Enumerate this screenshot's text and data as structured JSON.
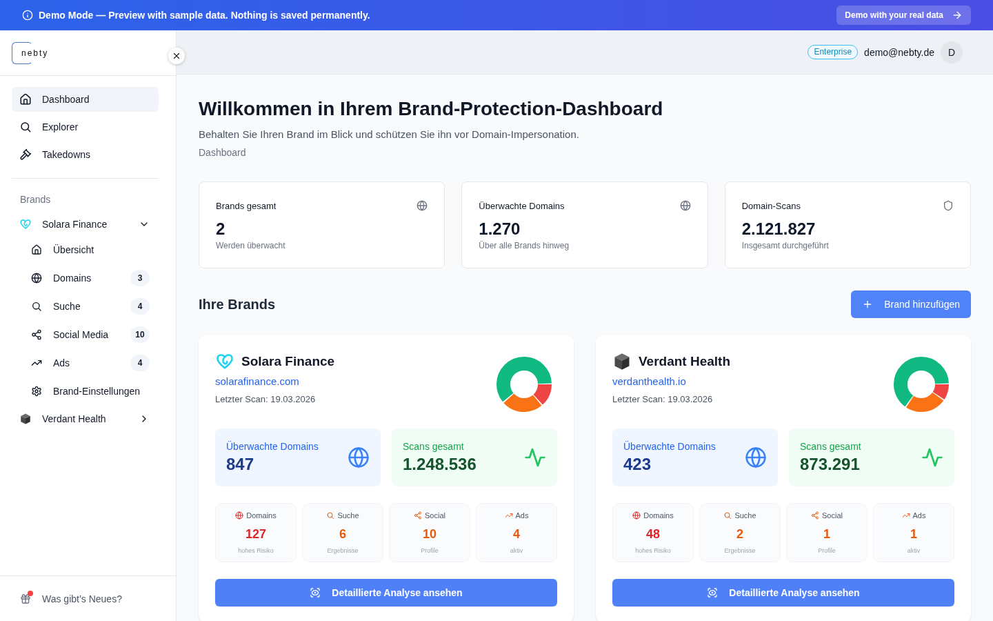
{
  "banner": {
    "title": "Demo Mode",
    "message": "— Preview with sample data. Nothing is saved permanently.",
    "action": "Demo with your real data"
  },
  "sidebar": {
    "logo": "nebty",
    "nav": [
      {
        "label": "Dashboard",
        "selected": true
      },
      {
        "label": "Explorer",
        "selected": false
      },
      {
        "label": "Takedowns",
        "selected": false
      }
    ],
    "section": "Brands",
    "brands": [
      {
        "name": "Solara Finance",
        "expanded": true,
        "children": [
          {
            "label": "Übersicht",
            "selected": false
          },
          {
            "label": "Domains",
            "count": "3",
            "selected": false
          },
          {
            "label": "Suche",
            "count": "4",
            "selected": false
          },
          {
            "label": "Social Media",
            "count": "10",
            "selected": false
          },
          {
            "label": "Ads",
            "count": "4",
            "selected": false
          },
          {
            "label": "Brand-Einstellungen",
            "selected": false
          }
        ]
      },
      {
        "name": "Verdant Health",
        "expanded": false
      }
    ],
    "footer": {
      "label": "Was gibt’s Neues?",
      "notification": true
    }
  },
  "header": {
    "plan": "Enterprise",
    "email": "demo@nebty.de",
    "avatar": "D"
  },
  "page": {
    "title": "Willkommen in Ihrem Brand-Protection-Dashboard",
    "subtitle": "Behalten Sie Ihren Brand im Blick und schützen Sie ihn vor Domain-Impersonation.",
    "breadcrumb": "Dashboard"
  },
  "stats": [
    {
      "label": "Brands gesamt",
      "value": "2",
      "note": "Werden überwacht"
    },
    {
      "label": "Überwachte Domains",
      "value": "1.270",
      "note": "Über alle Brands hinweg"
    },
    {
      "label": "Domain-Scans",
      "value": "2.121.827",
      "note": "Insgesamt durchgeführt"
    }
  ],
  "brands_section": {
    "title": "Ihre Brands",
    "add_button": "Brand hinzufügen"
  },
  "brand_cards": [
    {
      "name": "Solara Finance",
      "domain": "solarafinance.com",
      "last_scan": "Letzter Scan: 19.03.2026",
      "monitored": {
        "label": "Überwachte Domains",
        "value": "847"
      },
      "scans": {
        "label": "Scans gesamt",
        "value": "1.248.536"
      },
      "metrics": [
        {
          "label": "Domains",
          "value": "127",
          "note": "hohes Risiko",
          "color": "#dc2626"
        },
        {
          "label": "Suche",
          "value": "6",
          "note": "Ergebnisse",
          "color": "#ea580c"
        },
        {
          "label": "Social",
          "value": "10",
          "note": "Profile",
          "color": "#ea580c"
        },
        {
          "label": "Ads",
          "value": "4",
          "note": "aktiv",
          "color": "#ea580c"
        }
      ],
      "action": "Detaillierte Analyse ansehen"
    },
    {
      "name": "Verdant Health",
      "domain": "verdanthealth.io",
      "last_scan": "Letzter Scan: 19.03.2026",
      "monitored": {
        "label": "Überwachte Domains",
        "value": "423"
      },
      "scans": {
        "label": "Scans gesamt",
        "value": "873.291"
      },
      "metrics": [
        {
          "label": "Domains",
          "value": "48",
          "note": "hohes Risiko",
          "color": "#dc2626"
        },
        {
          "label": "Suche",
          "value": "2",
          "note": "Ergebnisse",
          "color": "#ea580c"
        },
        {
          "label": "Social",
          "value": "1",
          "note": "Profile",
          "color": "#ea580c"
        },
        {
          "label": "Ads",
          "value": "1",
          "note": "aktiv",
          "color": "#ea580c"
        }
      ],
      "action": "Detaillierte Analyse ansehen"
    }
  ]
}
